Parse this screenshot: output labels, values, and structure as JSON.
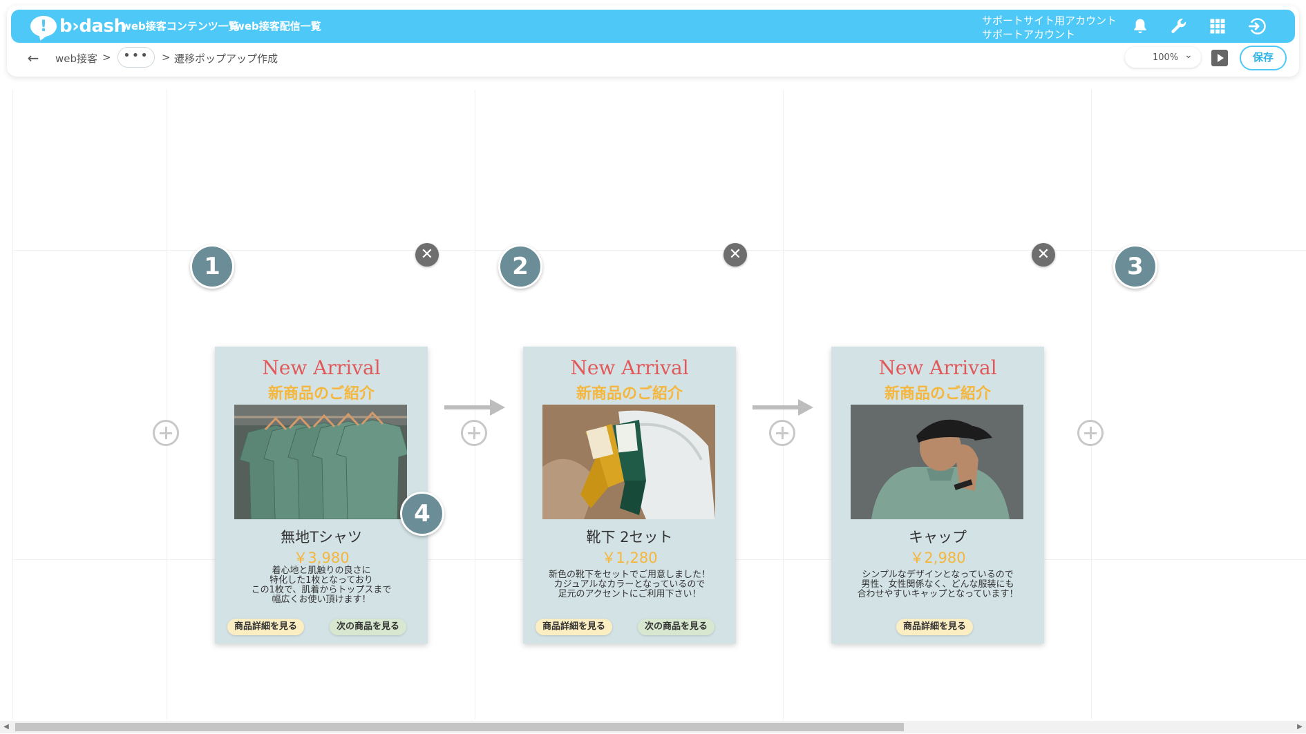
{
  "header": {
    "logo_text": "b›dash",
    "nav": [
      "web接客コンテンツ一覧",
      "web接客配信一覧"
    ],
    "account_line1": "サポートサイト用アカウント",
    "account_line2": "サポートアカウント",
    "icons": [
      "bell-icon",
      "wrench-icon",
      "grid-icon",
      "logout-icon"
    ]
  },
  "subbar": {
    "breadcrumb_root": "web接客",
    "sep1": ">",
    "ellipsis": "•••",
    "sep2": ">",
    "page_title": "遷移ポップアップ作成",
    "zoom": "100%",
    "save_label": "保存"
  },
  "cards": [
    {
      "title": "New Arrival",
      "subtitle": "新商品のご紹介",
      "product_name": "無地Tシャツ",
      "price": "￥3,980",
      "desc": [
        "着心地と肌触りの良さに",
        "特化した1枚となっており",
        "この1枚で、肌着からトップスまで",
        "幅広くお使い頂けます！"
      ],
      "detail_label": "商品詳細を見る",
      "next_label": "次の商品を見る"
    },
    {
      "title": "New Arrival",
      "subtitle": "新商品のご紹介",
      "product_name": "靴下 2セット",
      "price": "￥1,280",
      "desc": [
        "新色の靴下をセットでご用意しました！",
        "カジュアルなカラーとなっているので",
        "足元のアクセントにご利用下さい！"
      ],
      "detail_label": "商品詳細を見る",
      "next_label": "次の商品を見る"
    },
    {
      "title": "New Arrival",
      "subtitle": "新商品のご紹介",
      "product_name": "キャップ",
      "price": "￥2,980",
      "desc": [
        "シンプルなデザインとなっているので",
        "男性、女性関係なく、どんな服装にも",
        "合わせやすいキャップとなっています！"
      ],
      "detail_label": "商品詳細を見る"
    }
  ],
  "badges": [
    "1",
    "2",
    "3",
    "4"
  ],
  "close_glyph": "✕",
  "colors": {
    "header_bg": "#4ec8f7",
    "card_bg": "#d3e2e5",
    "title_red": "#e0585a",
    "accent_yellow": "#f5b63d",
    "badge": "#6a8d97"
  }
}
